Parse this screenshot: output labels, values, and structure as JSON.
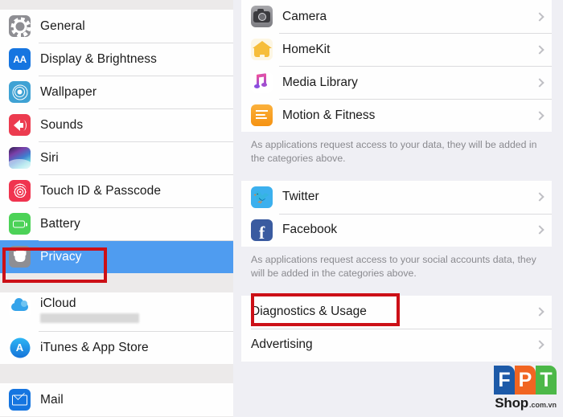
{
  "sidebar": {
    "header_strip": "",
    "groups": [
      {
        "items": [
          {
            "label": "General",
            "icon": "gear-icon",
            "icon_class": "ic-general",
            "selected": false
          },
          {
            "label": "Display & Brightness",
            "icon": "text-size-icon",
            "icon_class": "ic-display",
            "selected": false
          },
          {
            "label": "Wallpaper",
            "icon": "flower-icon",
            "icon_class": "ic-wallpaper",
            "selected": false
          },
          {
            "label": "Sounds",
            "icon": "speaker-icon",
            "icon_class": "ic-sounds",
            "selected": false
          },
          {
            "label": "Siri",
            "icon": "siri-icon",
            "icon_class": "ic-siri",
            "selected": false
          },
          {
            "label": "Touch ID & Passcode",
            "icon": "fingerprint-icon",
            "icon_class": "ic-touchid",
            "selected": false
          },
          {
            "label": "Battery",
            "icon": "battery-icon",
            "icon_class": "ic-battery",
            "selected": false
          },
          {
            "label": "Privacy",
            "icon": "hand-icon",
            "icon_class": "ic-privacy",
            "selected": true
          }
        ]
      },
      {
        "items": [
          {
            "label": "iCloud",
            "icon": "cloud-icon",
            "icon_class": "ic-icloud",
            "selected": false,
            "subtitle_redacted": true
          },
          {
            "label": "iTunes & App Store",
            "icon": "app-store-icon",
            "icon_class": "ic-itunes",
            "selected": false
          }
        ]
      },
      {
        "items": [
          {
            "label": "Mail",
            "icon": "envelope-icon",
            "icon_class": "ic-mail",
            "selected": false
          }
        ]
      }
    ]
  },
  "detail": {
    "group1": {
      "rows": [
        {
          "label": "Camera",
          "icon": "camera-icon",
          "icon_class": "ic-camera",
          "chevron": true
        },
        {
          "label": "HomeKit",
          "icon": "house-icon",
          "icon_class": "ic-homekit",
          "chevron": true
        },
        {
          "label": "Media Library",
          "icon": "music-note-icon",
          "icon_class": "ic-media",
          "chevron": true
        },
        {
          "label": "Motion & Fitness",
          "icon": "activity-icon",
          "icon_class": "ic-motion",
          "chevron": true
        }
      ],
      "footnote": "As applications request access to your data, they will be added in the categories above."
    },
    "group2": {
      "rows": [
        {
          "label": "Twitter",
          "icon": "twitter-icon",
          "icon_class": "ic-twitter",
          "chevron": true
        },
        {
          "label": "Facebook",
          "icon": "facebook-icon",
          "icon_class": "ic-facebook",
          "chevron": true
        }
      ],
      "footnote": "As applications request access to your social accounts data, they will be added in the categories above."
    },
    "group3": {
      "rows": [
        {
          "label": "Diagnostics & Usage",
          "icon": null,
          "icon_class": "",
          "chevron": true,
          "highlighted": true
        },
        {
          "label": "Advertising",
          "icon": null,
          "icon_class": "",
          "chevron": true,
          "highlighted": false
        }
      ]
    }
  },
  "annotations": {
    "color": "#cc1017",
    "boxes": [
      {
        "name": "privacy-highlight",
        "target": "Privacy"
      },
      {
        "name": "diagnostics-highlight",
        "target": "Diagnostics & Usage"
      }
    ]
  },
  "watermark": {
    "brand": "FPT",
    "letters": [
      "F",
      "P",
      "T"
    ],
    "colors": {
      "f": "#1d5aa8",
      "p": "#f16522",
      "t": "#4cb848"
    },
    "shop": "Shop",
    "tld": ".com.vn"
  },
  "theme": {
    "selection_blue": "#4f9cf0",
    "background": "#efeff4",
    "card": "#fefefe",
    "separator": "#dcdcde",
    "text": "#1b1b1b",
    "footnote_text": "#8a8a8f"
  }
}
